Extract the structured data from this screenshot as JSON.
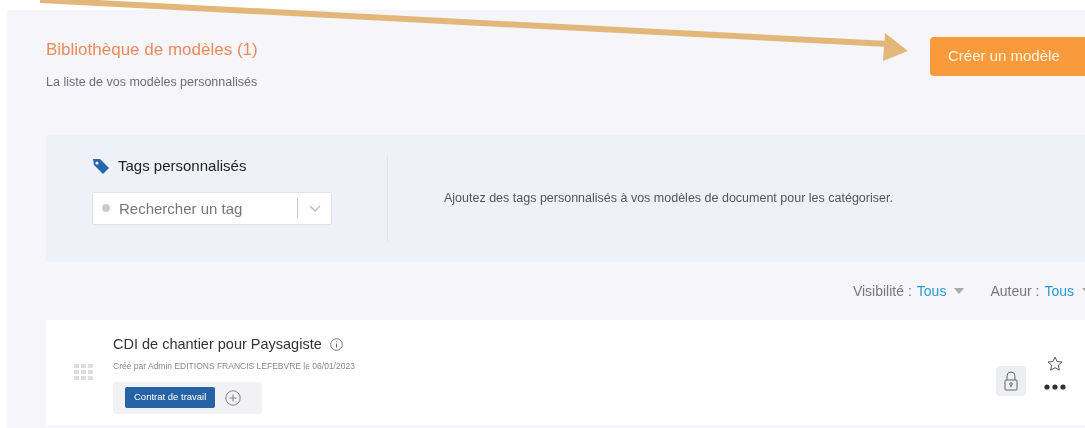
{
  "header": {
    "title": "Bibliothèque de modèles (1)",
    "subtitle": "La liste de vos modèles personnalisés",
    "create_button": "Créer un modèle"
  },
  "tags_panel": {
    "title": "Tags personnalisés",
    "search": {
      "placeholder": "Rechercher un tag"
    },
    "description": "Ajoutez des tags personnalisés à vos modèles de document pour les catégoriser."
  },
  "filters": [
    {
      "label": "Visibilité :",
      "value": "Tous"
    },
    {
      "label": "Auteur :",
      "value": "Tous"
    }
  ],
  "templates": [
    {
      "title": "CDI de chantier pour Paysagiste",
      "meta": "Créé par Admin EDITIONS FRANCIS LEFEBVRE le 06/01/2023",
      "tags": [
        "Contrat de travail"
      ],
      "locked": true,
      "favorite": false
    }
  ]
}
